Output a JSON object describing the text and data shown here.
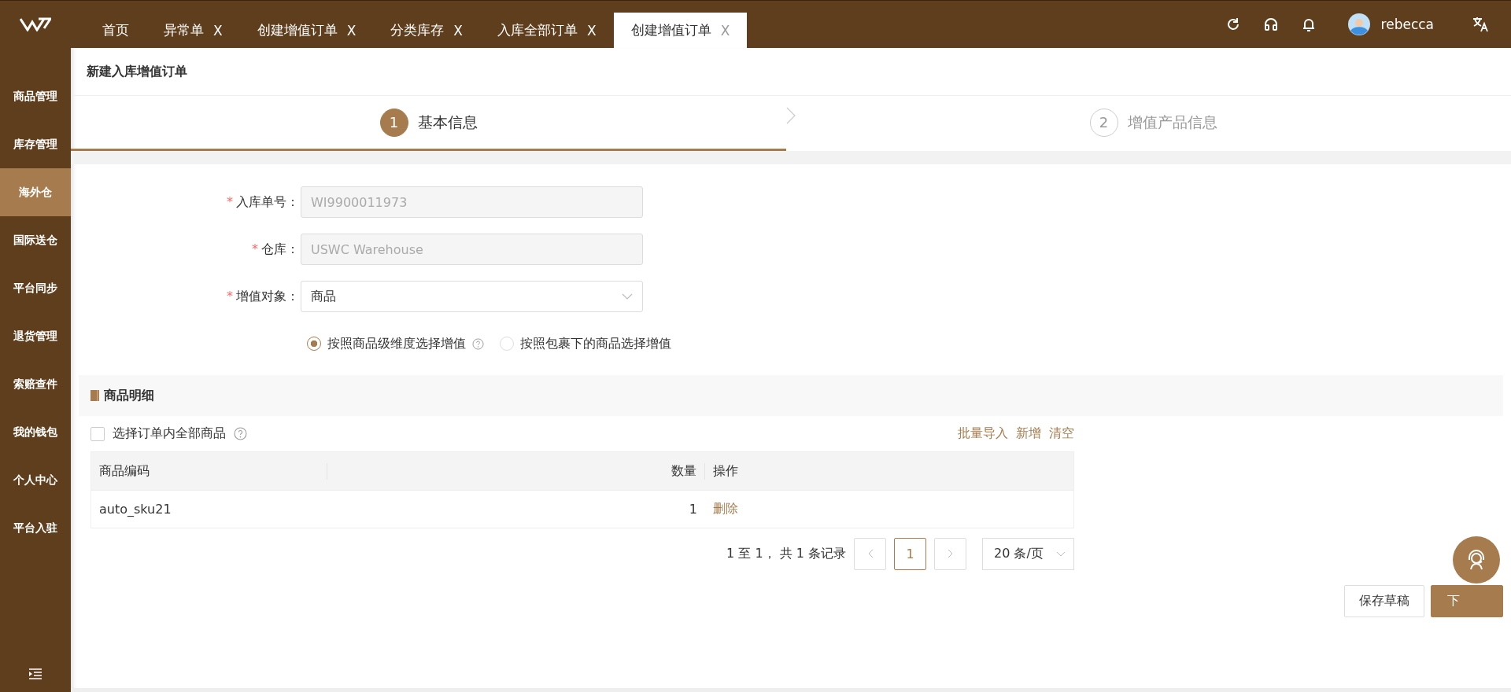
{
  "tabs": [
    {
      "label": "首页",
      "selected": false
    },
    {
      "label": "异常单",
      "close": "X",
      "selected": false
    },
    {
      "label": "创建增值订单",
      "close": "X",
      "selected": false
    },
    {
      "label": "分类库存",
      "close": "X",
      "selected": false
    },
    {
      "label": "入库全部订单",
      "close": "X",
      "selected": false
    },
    {
      "label": "创建增值订单",
      "close": "X",
      "selected": true
    }
  ],
  "user": {
    "name": "rebecca"
  },
  "sidebar": {
    "items": [
      {
        "label": "商品管理",
        "selected": false
      },
      {
        "label": "库存管理",
        "selected": false
      },
      {
        "label": "海外仓",
        "selected": true
      },
      {
        "label": "国际送仓",
        "selected": false
      },
      {
        "label": "平台同步",
        "selected": false
      },
      {
        "label": "退货管理",
        "selected": false
      },
      {
        "label": "索赔查件",
        "selected": false
      },
      {
        "label": "我的钱包",
        "selected": false
      },
      {
        "label": "个人中心",
        "selected": false
      },
      {
        "label": "平台入驻",
        "selected": false
      }
    ]
  },
  "page_title": "新建入库增值订单",
  "steps": [
    {
      "number": "1",
      "label": "基本信息",
      "selected": true
    },
    {
      "number": "2",
      "label": "增值产品信息",
      "selected": false
    }
  ],
  "form": {
    "fields": [
      {
        "required_mark": "*",
        "label": "入库单号：",
        "kind": "input",
        "value": "WI9900011973",
        "disabled": true
      },
      {
        "required_mark": "*",
        "label": "仓库：",
        "kind": "input",
        "value": "USWC Warehouse",
        "disabled": true
      },
      {
        "required_mark": "*",
        "label": "增值对象：",
        "kind": "select",
        "value": "商品",
        "disabled": false
      }
    ],
    "radios": [
      {
        "kind": "help",
        "label": "按照商品级维度选择增值",
        "selected": true
      },
      {
        "kind": "plain",
        "label": "按照包裹下的商品选择增值",
        "selected": false
      }
    ]
  },
  "section": {
    "title": "商品明细",
    "select_all": {
      "label": "选择订单内全部商品",
      "checked": false
    },
    "actions": [
      "批量导入",
      "新增",
      "清空"
    ],
    "table": {
      "columns": [
        "商品编码",
        "数量",
        "操作"
      ],
      "rows": [
        {
          "code": "auto_sku21",
          "qty": "1",
          "action": "删除"
        }
      ]
    },
    "pagination": {
      "summary": "1 至 1， 共 1 条记录",
      "pages": [
        {
          "label": "1",
          "selected": true
        }
      ],
      "page_size": "20 条/页"
    }
  },
  "buttons": [
    {
      "label": "保存草稿",
      "kind": "default"
    },
    {
      "label": "下",
      "kind": "primary"
    }
  ]
}
